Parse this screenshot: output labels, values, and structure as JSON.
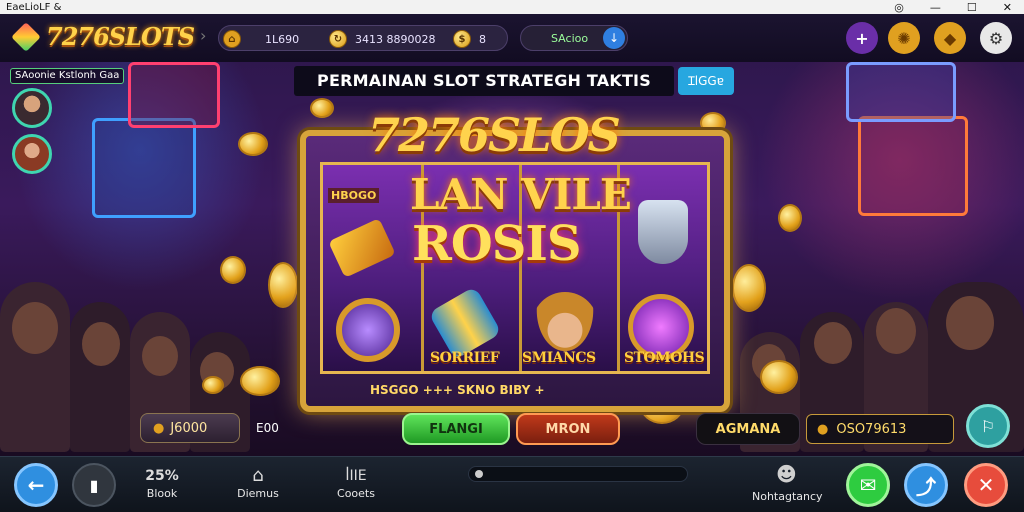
{
  "window": {
    "title": "EaeLioLF &",
    "controls": [
      "◎",
      "—",
      "☐",
      "✕"
    ]
  },
  "header": {
    "logo": "7276SLOTS",
    "balance_a": "1L690",
    "balance_b": "3413 8890028",
    "balance_c": "8",
    "status": "SAcioo",
    "icons": [
      "home-icon",
      "refresh-icon",
      "coin-icon",
      "info-icon",
      "plus-icon",
      "gift-icon",
      "diamond-icon",
      "settings-icon"
    ]
  },
  "sidebar": {
    "label": "SAoonie Kstlonh Gaa"
  },
  "banner": {
    "title": "PERMAINAN SLOT STRATEGH TAKTIS",
    "button": "ꞮlGGɐ"
  },
  "machine": {
    "title_line1": "7276SLOS",
    "title_line2": "LAN VILE",
    "title_line3": "ROSIS",
    "tag": "HBOGO",
    "symbols": [
      "SORRIEF",
      "SMIANCS",
      "STOMOHS"
    ],
    "footer": "HSGGO  +++  SKNO  BIBY  +"
  },
  "controls": {
    "bet_label": "J6000",
    "bet_value": "E00",
    "play": "FLANGI",
    "mode": "MRON",
    "agmana": "AGMANA",
    "win_value": "OSO79613"
  },
  "nav": {
    "items": [
      {
        "top": "25%",
        "label": "Blook"
      },
      {
        "top": "⌂",
        "label": "Diemus"
      },
      {
        "top": "ꟾIIE",
        "label": "Cooets"
      }
    ],
    "right_label": "Nohtagtancy"
  },
  "colors": {
    "accent": "#ffd24a",
    "hud_bg": "#1b1430",
    "nav_bg": "#1c2430",
    "play_green": "#2ecc40",
    "close_red": "#e74c3c"
  }
}
